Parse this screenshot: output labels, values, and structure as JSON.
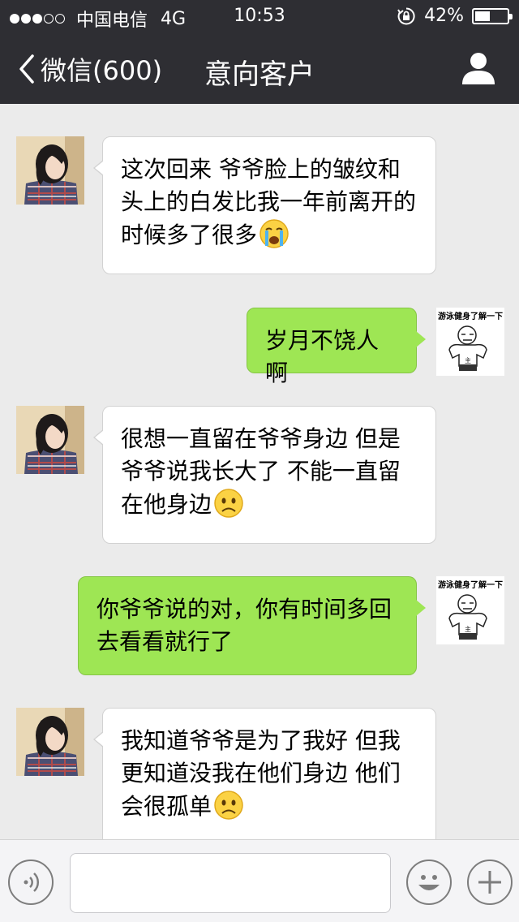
{
  "status_bar": {
    "signal_dots": [
      true,
      true,
      true,
      false,
      false
    ],
    "carrier": "中国电信",
    "network": "4G",
    "time": "10:53",
    "battery": "42%",
    "battery_level": 0.42
  },
  "nav": {
    "back_label": "微信(600)",
    "title": "意向客户",
    "profile_icon": "person-icon"
  },
  "messages": [
    {
      "side": "in",
      "text": "这次回来 爷爷脸上的皱纹和头上的白发比我一年前离开的时候多了很多",
      "emoji": "crying-emoji"
    },
    {
      "side": "out",
      "text": "岁月不饶人啊",
      "sticker_caption": "游泳健身了解一下"
    },
    {
      "side": "in",
      "text": "很想一直留在爷爷身边 但是爷爷说我长大了 不能一直留在他身边",
      "emoji": "frown-emoji"
    },
    {
      "side": "out",
      "text": "你爷爷说的对，你有时间多回去看看就行了",
      "sticker_caption": "游泳健身了解一下"
    },
    {
      "side": "in",
      "text": "我知道爷爷是为了我好 但我更知道没我在他们身边 他们会很孤单",
      "emoji": "frown-emoji"
    }
  ],
  "input_bar": {
    "voice_icon": "voice-icon",
    "input_value": "",
    "emoji_icon": "emoji-icon",
    "plus_icon": "plus-icon"
  },
  "colors": {
    "bar_bg": "#2e2e33",
    "chat_bg": "#ebebeb",
    "out_bubble": "#9ee654",
    "in_bubble": "#ffffff"
  }
}
